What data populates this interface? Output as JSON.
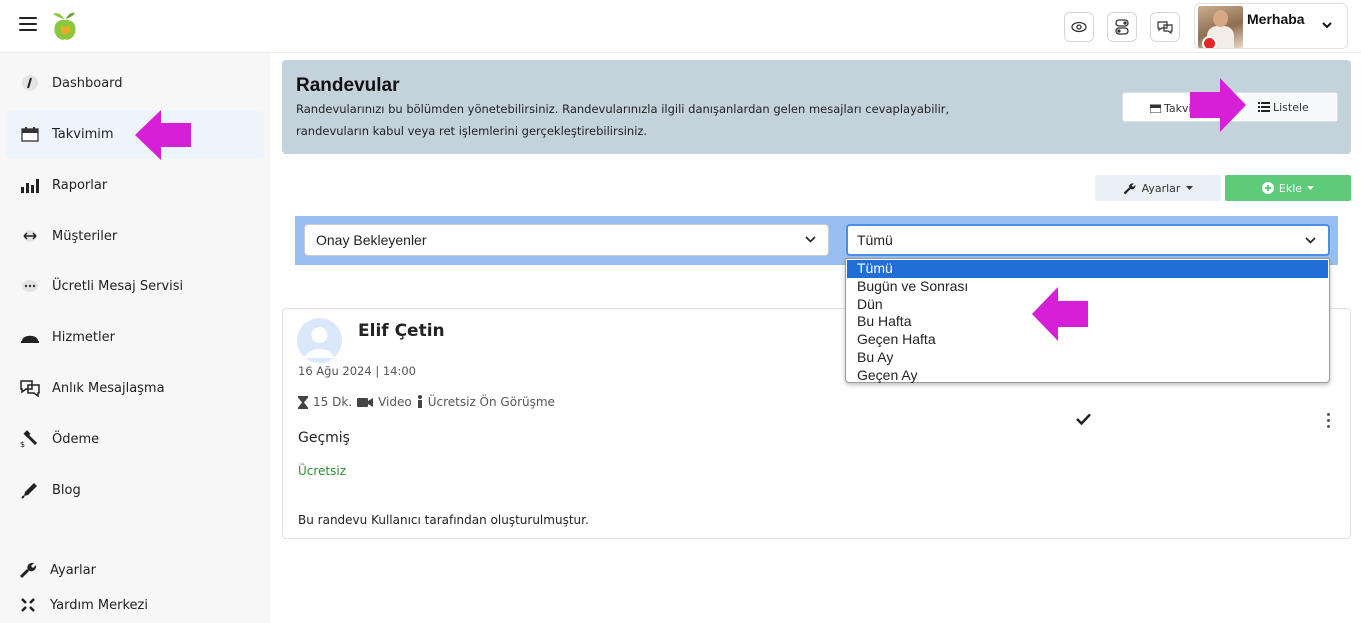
{
  "topbar": {
    "user_name": "Merhaba"
  },
  "sidebar": {
    "items": [
      {
        "label": "Dashboard",
        "icon": "gauge-icon"
      },
      {
        "label": "Takvimim",
        "icon": "calendar-icon",
        "active": true
      },
      {
        "label": "Raporlar",
        "icon": "bar-chart-icon"
      },
      {
        "label": "Müşteriler",
        "icon": "arrows-horizontal-icon"
      },
      {
        "label": "Ücretli Mesaj Servisi",
        "icon": "chat-dots-icon"
      },
      {
        "label": "Hizmetler",
        "icon": "dome-icon"
      },
      {
        "label": "Anlık Mesajlaşma",
        "icon": "chat-bubbles-icon"
      },
      {
        "label": "Ödeme",
        "icon": "payment-icon"
      },
      {
        "label": "Blog",
        "icon": "pen-icon"
      }
    ],
    "bottom_items": [
      {
        "label": "Ayarlar",
        "icon": "wrench-icon"
      },
      {
        "label": "Yardım Merkezi",
        "icon": "help-arrows-icon"
      }
    ]
  },
  "header": {
    "title": "Randevular",
    "description": "Randevularınızı bu bölümden yönetebilirsiniz. Randevularınızla ilgili danışanlardan gelen mesajları cevaplayabilir, randevuların kabul veya ret işlemlerini gerçekleştirebilirsiniz.",
    "view_calendar_label": "Takvim",
    "view_list_label": "Listele"
  },
  "toolbar": {
    "settings_label": "Ayarlar",
    "add_label": "Ekle"
  },
  "filters": {
    "status_value": "Onay Bekleyenler",
    "period_value": "Tümü",
    "period_options": [
      "Tümü",
      "Bugün ve Sonrası",
      "Dün",
      "Bu Hafta",
      "Geçen Hafta",
      "Bu Ay",
      "Geçen Ay"
    ]
  },
  "appointment": {
    "name": "Elif Çetin",
    "datetime": "16 Ağu 2024 | 14:00",
    "duration": "15 Dk.",
    "channel": "Video",
    "type": "Ücretsiz Ön Görüşme",
    "status": "Geçmiş",
    "price": "Ücretsiz",
    "note": "Bu randevu Kullanıcı tarafından oluşturulmuştur."
  },
  "colors": {
    "header_bg": "#c4d2dc",
    "filter_bg": "#99bff1",
    "add_button": "#5dcb79",
    "selected_option": "#1f6fd6",
    "annotation_arrow": "#d61fd6"
  }
}
